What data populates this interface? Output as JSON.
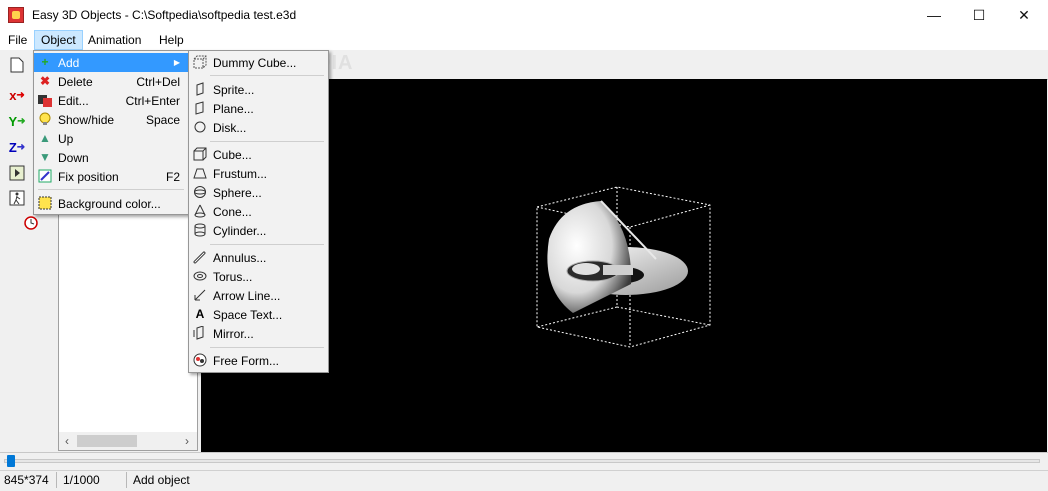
{
  "window": {
    "title": "Easy 3D Objects - C:\\Softpedia\\softpedia test.e3d",
    "minimize_glyph": "—",
    "maximize_glyph": "☐",
    "close_glyph": "✕"
  },
  "menubar": {
    "items": [
      "File",
      "Object",
      "Animation",
      "Help"
    ],
    "active": "Object"
  },
  "object_menu": {
    "items": [
      {
        "label": "Add",
        "shortcut": "",
        "icon": "add-icon",
        "submenu": true,
        "highlighted": true
      },
      {
        "label": "Delete",
        "shortcut": "Ctrl+Del",
        "icon": "delete-icon"
      },
      {
        "label": "Edit...",
        "shortcut": "Ctrl+Enter",
        "icon": "edit-icon"
      },
      {
        "label": "Show/hide",
        "shortcut": "Space",
        "icon": "bulb-icon"
      },
      {
        "label": "Up",
        "shortcut": "",
        "icon": "arrow-up-icon"
      },
      {
        "label": "Down",
        "shortcut": "",
        "icon": "arrow-down-icon"
      },
      {
        "label": "Fix position",
        "shortcut": "F2",
        "icon": "fix-position-icon"
      },
      {
        "label": "Background color...",
        "shortcut": "",
        "icon": "background-color-icon"
      }
    ],
    "submenu_arrow": "▶"
  },
  "add_submenu": {
    "items": [
      {
        "label": "Dummy Cube...",
        "icon": "dummy-cube-icon"
      },
      {
        "label": "Sprite...",
        "icon": "sprite-icon"
      },
      {
        "label": "Plane...",
        "icon": "plane-icon"
      },
      {
        "label": "Disk...",
        "icon": "disk-icon"
      },
      {
        "label": "Cube...",
        "icon": "cube-icon"
      },
      {
        "label": "Frustum...",
        "icon": "frustum-icon"
      },
      {
        "label": "Sphere...",
        "icon": "sphere-icon"
      },
      {
        "label": "Cone...",
        "icon": "cone-icon"
      },
      {
        "label": "Cylinder...",
        "icon": "cylinder-icon"
      },
      {
        "label": "Annulus...",
        "icon": "annulus-icon"
      },
      {
        "label": "Torus...",
        "icon": "torus-icon"
      },
      {
        "label": "Arrow Line...",
        "icon": "arrow-line-icon"
      },
      {
        "label": "Space Text...",
        "icon": "space-text-icon"
      },
      {
        "label": "Mirror...",
        "icon": "mirror-icon"
      },
      {
        "label": "Free Form...",
        "icon": "free-form-icon"
      }
    ]
  },
  "toolbar": {
    "axis_x": "x",
    "axis_y": "Y",
    "axis_z": "Z"
  },
  "status": {
    "dimensions": "845*374",
    "frame": "1/1000",
    "message": "Add object"
  },
  "watermark": "SOFTPEDIA",
  "colors": {
    "menu_highlight": "#3399ff",
    "viewport_bg": "#000000",
    "slider_thumb": "#0078d7"
  }
}
